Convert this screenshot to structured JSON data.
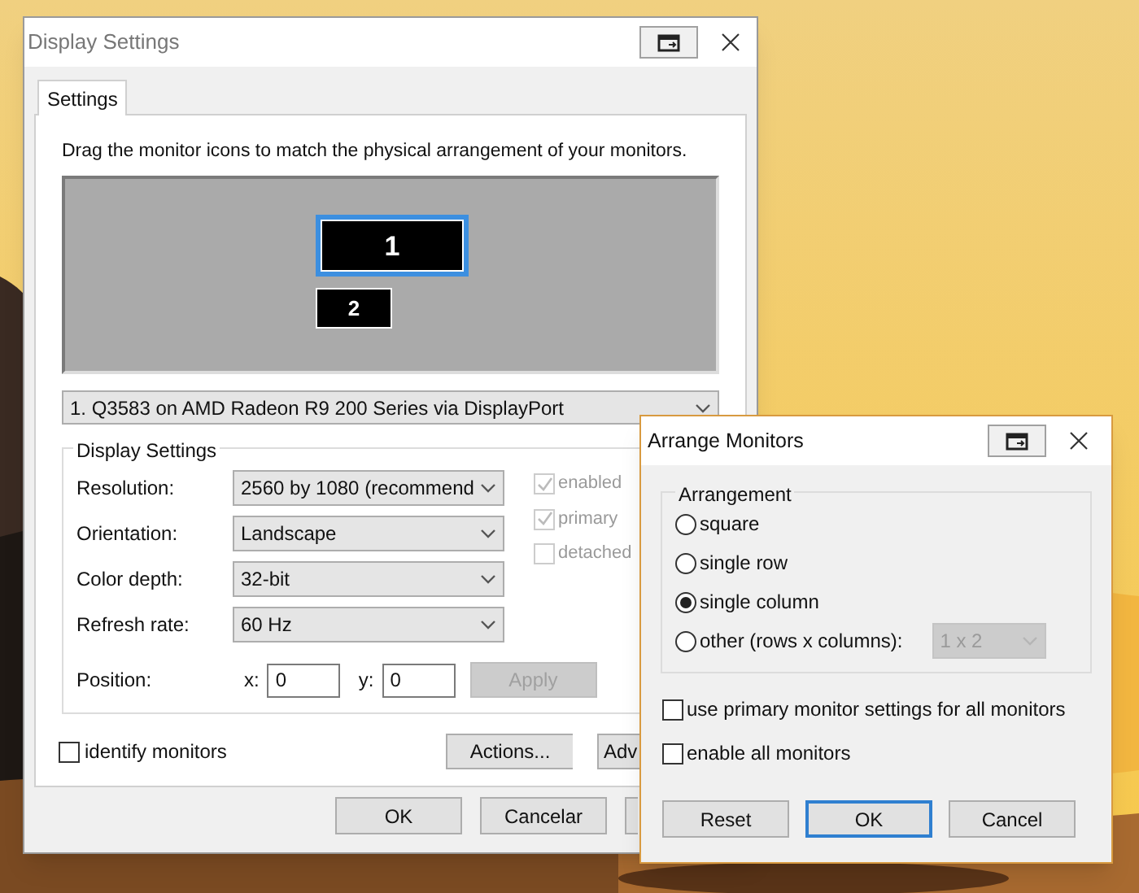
{
  "main_window": {
    "title": "Display Settings",
    "tabs": [
      {
        "label": "Settings",
        "selected": true
      }
    ],
    "instruction": "Drag the monitor icons to match the physical arrangement of your monitors.",
    "monitors": [
      {
        "label": "1",
        "selected": true
      },
      {
        "label": "2",
        "selected": false
      }
    ],
    "display_select": "1. Q3583 on AMD Radeon R9 200 Series via DisplayPort",
    "group": {
      "title": "Display Settings",
      "fields": [
        {
          "label": "Resolution:",
          "value": "2560 by 1080  (recommend"
        },
        {
          "label": "Orientation:",
          "value": "Landscape"
        },
        {
          "label": "Color depth:",
          "value": "32-bit"
        },
        {
          "label": "Refresh rate:",
          "value": "60 Hz"
        }
      ],
      "flags": [
        {
          "label": "enabled",
          "checked": true,
          "disabled": true
        },
        {
          "label": "primary",
          "checked": true,
          "disabled": true
        },
        {
          "label": "detached",
          "checked": false,
          "disabled": true
        }
      ],
      "position": {
        "label": "Position:",
        "x_label": "x:",
        "x_value": "0",
        "y_label": "y:",
        "y_value": "0",
        "apply": {
          "label": "Apply",
          "disabled": true
        }
      }
    },
    "identify": {
      "label": "identify monitors",
      "checked": false
    },
    "action_buttons": [
      "Actions...",
      "Adv"
    ],
    "footer_buttons": [
      "OK",
      "Cancelar"
    ]
  },
  "arrange_window": {
    "title": "Arrange Monitors",
    "group_title": "Arrangement",
    "options": [
      {
        "kind": "plain",
        "label": "square",
        "selected": false
      },
      {
        "kind": "plain",
        "label": "single row",
        "selected": false
      },
      {
        "kind": "plain",
        "label": "single column",
        "selected": true
      },
      {
        "kind": "grid",
        "label": "other (rows x columns):",
        "selected": false,
        "value": "1 x 2",
        "disabled": true
      }
    ],
    "checkboxes": [
      {
        "label": "use primary monitor settings for all monitors",
        "checked": false
      },
      {
        "label": "enable all monitors",
        "checked": false
      }
    ],
    "buttons": [
      {
        "label": "Reset",
        "default": false
      },
      {
        "label": "OK",
        "default": true
      },
      {
        "label": "Cancel",
        "default": false
      }
    ]
  }
}
